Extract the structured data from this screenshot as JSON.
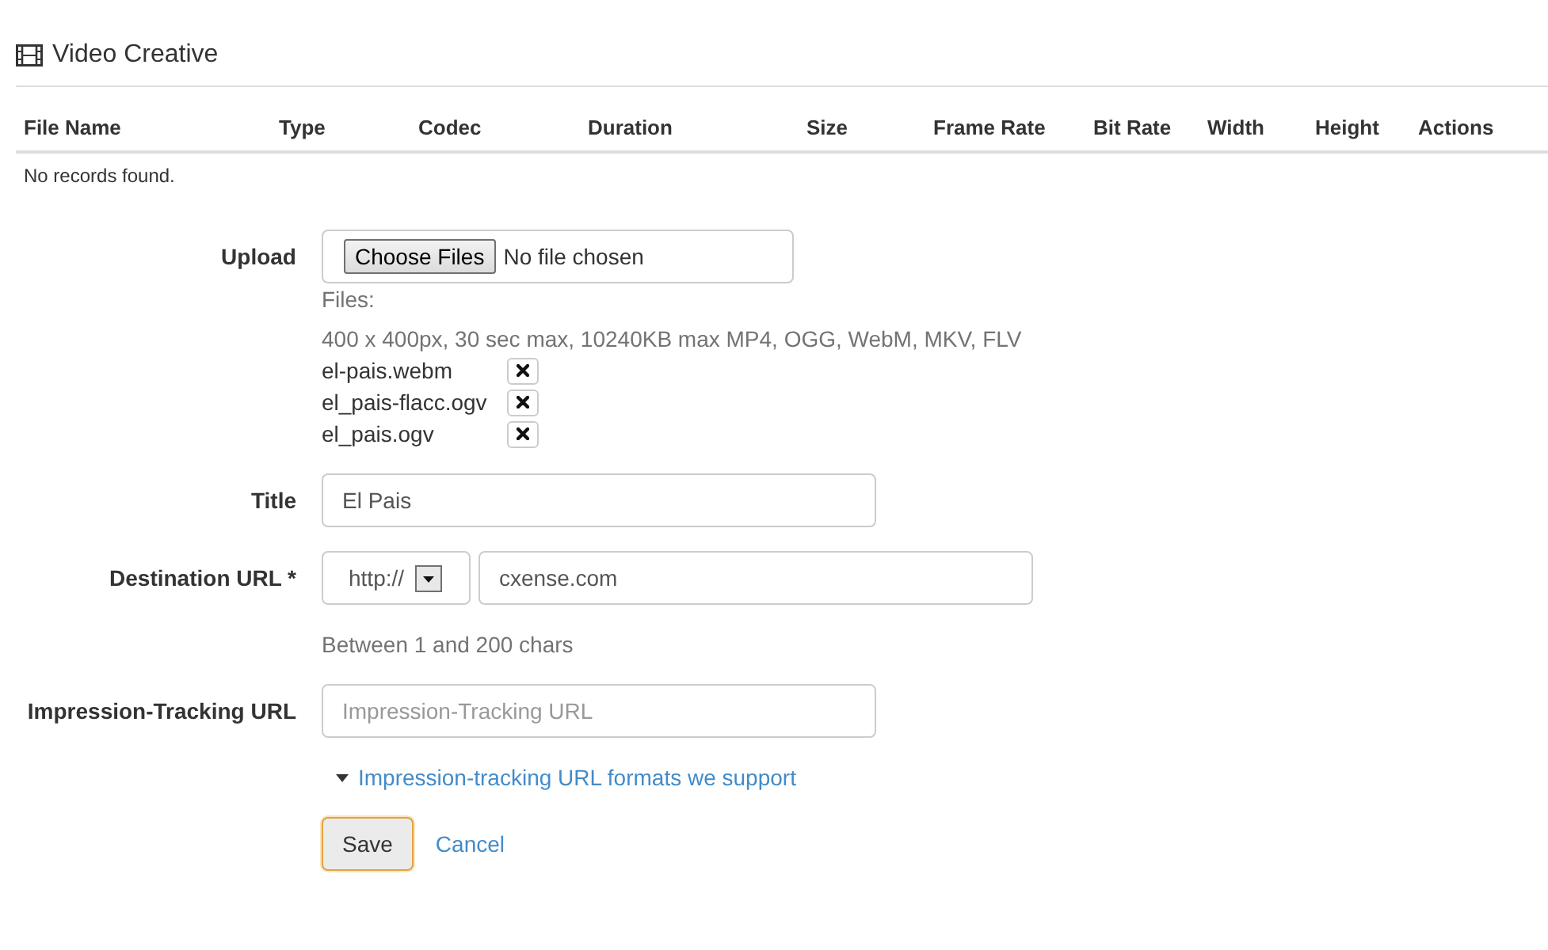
{
  "section": {
    "title": "Video Creative"
  },
  "table": {
    "columns": [
      "File Name",
      "Type",
      "Codec",
      "Duration",
      "Size",
      "Frame Rate",
      "Bit Rate",
      "Width",
      "Height",
      "Actions"
    ],
    "empty_message": "No records found."
  },
  "form": {
    "fields": [
      {
        "kind": "upload",
        "label": "Upload",
        "button": "Choose Files",
        "status": "No file chosen",
        "files_label": "Files:",
        "help": "400 x 400px, 30 sec max, 10240KB max MP4, OGG, WebM, MKV, FLV",
        "files": [
          "el-pais.webm",
          "el_pais-flacc.ogv",
          "el_pais.ogv"
        ]
      },
      {
        "kind": "text",
        "label": "Title",
        "value": "El Pais"
      },
      {
        "kind": "url",
        "label": "Destination URL *",
        "scheme": "http://",
        "value": "cxense.com",
        "help": "Between 1 and 200 chars"
      },
      {
        "kind": "text",
        "label": "Impression-Tracking URL",
        "placeholder": "Impression-Tracking URL",
        "link": "Impression-tracking URL formats we support"
      }
    ]
  },
  "buttons": [
    {
      "kind": "button",
      "label": "Save",
      "focused": true
    },
    {
      "kind": "link",
      "label": "Cancel"
    }
  ]
}
